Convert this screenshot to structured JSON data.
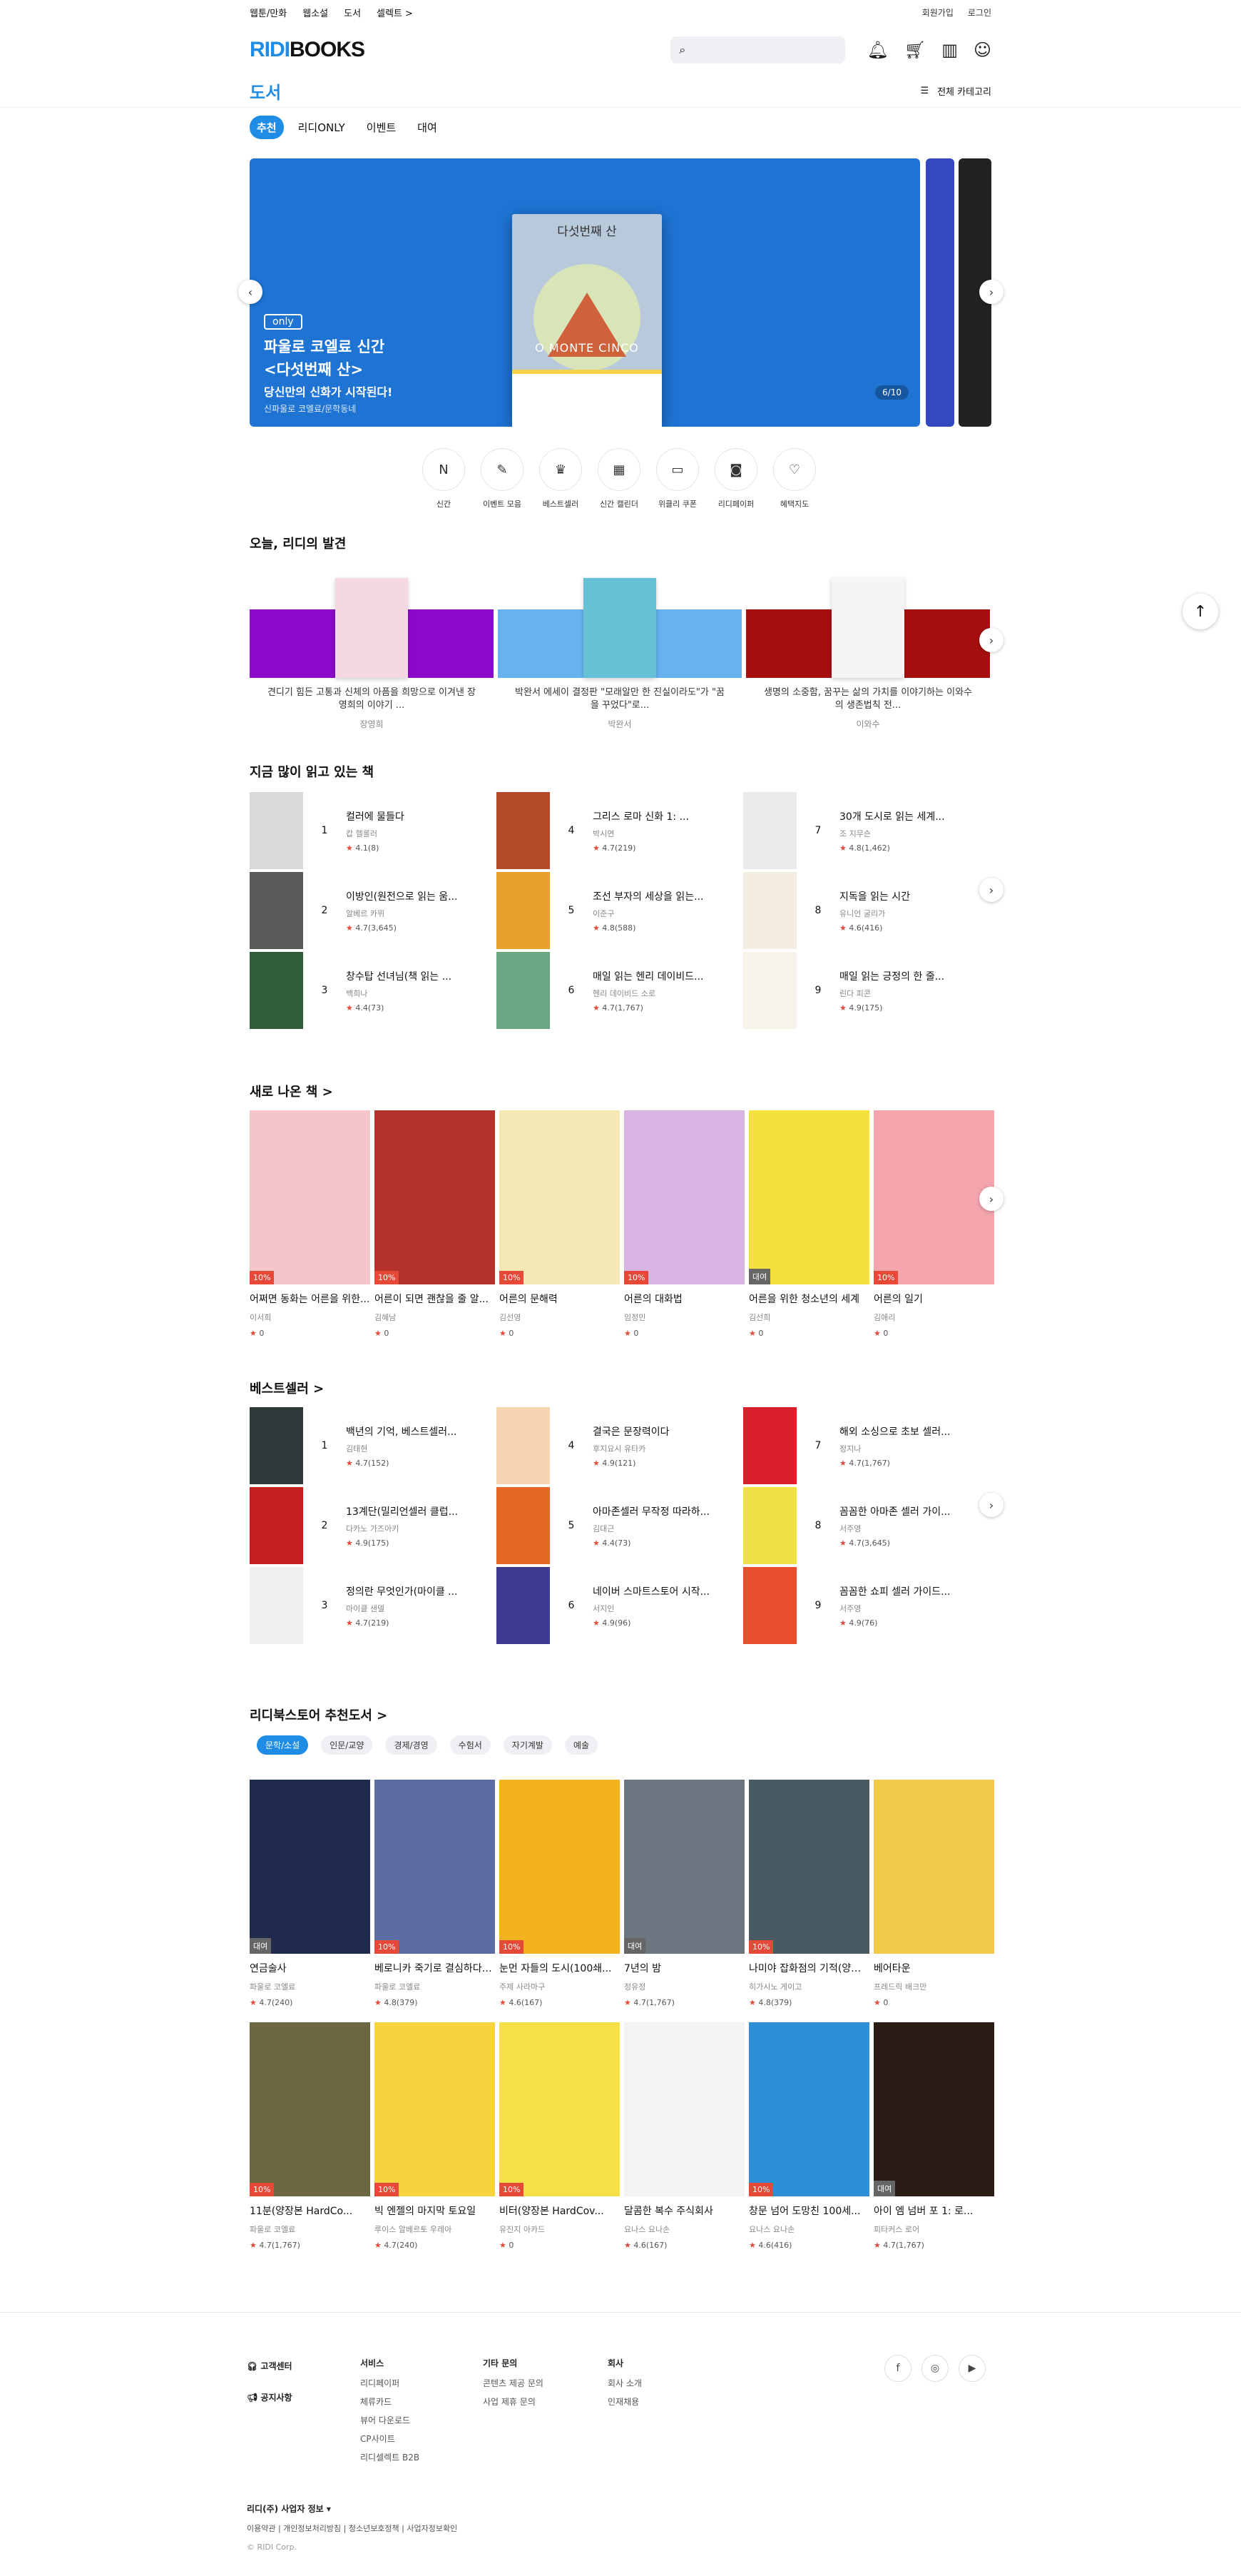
{
  "topnav": {
    "links": [
      "웹툰/만화",
      "웹소설",
      "도서",
      "셀렉트 >"
    ],
    "signup": "회원가입",
    "login": "로그인"
  },
  "header": {
    "logo_a": "RIDI",
    "logo_b": "BOOKS",
    "icons": [
      "search-icon",
      "bell-icon",
      "cart-icon",
      "library-icon",
      "user-icon"
    ]
  },
  "page": {
    "title": "도서",
    "all_categories": "전체 카테고리",
    "tabs": [
      "추천",
      "리디ONLY",
      "이벤트",
      "대여"
    ]
  },
  "banner": {
    "book_title": "다섯번째 산",
    "book_en": "O MONTE CINCO",
    "badge": "only",
    "line1": "파울로 코엘료 신간",
    "line2": "<다섯번째 산>",
    "line3": "당신만의 신화가 시작된다!",
    "caption": "신파울로 코엘료/문학동네",
    "page": "6/10"
  },
  "quick_menu": [
    {
      "icon": "N",
      "label": "신간"
    },
    {
      "icon": "✎",
      "label": "이벤트 모음"
    },
    {
      "icon": "♛",
      "label": "베스트셀러"
    },
    {
      "icon": "▦",
      "label": "신간 캘린더"
    },
    {
      "icon": "▭",
      "label": "위클리 쿠폰"
    },
    {
      "icon": "◙",
      "label": "리디페이퍼"
    },
    {
      "icon": "♡",
      "label": "혜택지도"
    }
  ],
  "discovery": {
    "title": "오늘, 리디의 발견",
    "items": [
      {
        "desc": "견디기 힘든 고통과 신체의 아픔을 희망으로 이겨낸 장영희의 이야기 ...",
        "author": "장영희",
        "bg": "#8b0ac9",
        "cover": "#f4d9e3"
      },
      {
        "desc": "박완서 에세이 결정판 \"모래알만 한 진실이라도\"가 \"꿈을 꾸었다\"로...",
        "author": "박완서",
        "bg": "#67b2ef",
        "cover": "#66c1d4"
      },
      {
        "desc": "생명의 소중함, 꿈꾸는 삶의 가치를 이야기하는 이와수의 생존법칙 전...",
        "author": "이와수",
        "bg": "#a50f0f",
        "cover": "#f5f5f5"
      }
    ]
  },
  "reading": {
    "title": "지금 많이 읽고 있는 책",
    "items": [
      {
        "rank": "1",
        "title": "컬러에 물들다",
        "author": "캅 헬롤러",
        "rating": "4.1",
        "count": "(8)",
        "color": "#d9d9d9"
      },
      {
        "rank": "2",
        "title": "이방인(원전으로 읽는 움...",
        "author": "알베르 카뮈",
        "rating": "4.7",
        "count": "(3,645)",
        "color": "#5a5a5a"
      },
      {
        "rank": "3",
        "title": "창수탑 선녀님(책 읽는 ...",
        "author": "백희나",
        "rating": "4.4",
        "count": "(73)",
        "color": "#2f5d3a"
      },
      {
        "rank": "4",
        "title": "그리스 로마 신화 1: ...",
        "author": "박시연",
        "rating": "4.7",
        "count": "(219)",
        "color": "#b54a2b"
      },
      {
        "rank": "5",
        "title": "조선 부자의 세상을 읽는...",
        "author": "이준구",
        "rating": "4.8",
        "count": "(588)",
        "color": "#e9a12e"
      },
      {
        "rank": "6",
        "title": "매일 읽는 헨리 데이비드...",
        "author": "헨리 데이비드 소로",
        "rating": "4.7",
        "count": "(1,767)",
        "color": "#6aa584"
      },
      {
        "rank": "7",
        "title": "30개 도시로 읽는 세계...",
        "author": "조 지무슨",
        "rating": "4.8",
        "count": "(1,462)",
        "color": "#eaeaea"
      },
      {
        "rank": "8",
        "title": "지독을 읽는 시간",
        "author": "유니언 굴리가",
        "rating": "4.6",
        "count": "(416)",
        "color": "#f3ede2"
      },
      {
        "rank": "9",
        "title": "매일 읽는 긍정의 한 줄...",
        "author": "린다 피콘",
        "rating": "4.9",
        "count": "(175)",
        "color": "#f7f2ea"
      }
    ]
  },
  "new_books": {
    "title": "새로 나온 책 >",
    "items": [
      {
        "title": "어쩌면 동화는 어른을 위한...",
        "author": "이서희",
        "rating": "0",
        "badge": "10%",
        "color": "#f5c6c9"
      },
      {
        "title": "어른이 되면 괜찮을 줄 알...",
        "author": "김혜남",
        "rating": "0",
        "badge": "10%",
        "color": "#b5312b"
      },
      {
        "title": "어른의 문해력",
        "author": "김선영",
        "rating": "0",
        "badge": "10%",
        "color": "#f6e8b5"
      },
      {
        "title": "어른의 대화법",
        "author": "임정민",
        "rating": "0",
        "badge": "10%",
        "color": "#d8b4e2"
      },
      {
        "title": "어른을 위한 청소년의 세계",
        "author": "김선희",
        "rating": "0",
        "badge": "대여",
        "color": "#f3e23c"
      },
      {
        "title": "어른의 일기",
        "author": "김애리",
        "rating": "0",
        "badge": "10%",
        "color": "#f3a4ad"
      }
    ]
  },
  "bestseller": {
    "title": "베스트셀러 >",
    "items": [
      {
        "rank": "1",
        "title": "백년의 기억, 베스트셀러...",
        "author": "김태현",
        "rating": "4.7",
        "count": "(152)",
        "color": "#2e3b3a"
      },
      {
        "rank": "2",
        "title": "13계단(밀리언셀러 클럽...",
        "author": "다카노 가즈아키",
        "rating": "4.9",
        "count": "(175)",
        "color": "#c41f1f"
      },
      {
        "rank": "3",
        "title": "정의란 무엇인가(마이클 ...",
        "author": "마이클 샌델",
        "rating": "4.7",
        "count": "(219)",
        "color": "#efefef"
      },
      {
        "rank": "4",
        "title": "결국은 문장력이다",
        "author": "후지요시 유타카",
        "rating": "4.9",
        "count": "(121)",
        "color": "#f6d6b2"
      },
      {
        "rank": "5",
        "title": "아마존셀러 무작정 따라하...",
        "author": "김대근",
        "rating": "4.4",
        "count": "(73)",
        "color": "#e46725"
      },
      {
        "rank": "6",
        "title": "네이버 스마트스토어 시작...",
        "author": "서지인",
        "rating": "4.9",
        "count": "(96)",
        "color": "#3e3a90"
      },
      {
        "rank": "7",
        "title": "해외 소싱으로 초보 셀러...",
        "author": "정지나",
        "rating": "4.7",
        "count": "(1,767)",
        "color": "#d81f2a"
      },
      {
        "rank": "8",
        "title": "꼼꼼한 아마존 셀러 가이...",
        "author": "서주영",
        "rating": "4.7",
        "count": "(3,645)",
        "color": "#f1e044"
      },
      {
        "rank": "9",
        "title": "꼼꼼한 쇼피 셀러 가이드...",
        "author": "서주영",
        "rating": "4.9",
        "count": "(76)",
        "color": "#e94f2c"
      }
    ]
  },
  "recommend": {
    "title": "리디북스토어 추천도서 >",
    "chips": [
      "문학/소설",
      "인문/교양",
      "경제/경영",
      "수험서",
      "자기계발",
      "예술"
    ],
    "row1": [
      {
        "title": "연금술사",
        "author": "파울로 코엘료",
        "rating": "4.7",
        "count": "(240)",
        "badge": "대여",
        "color": "#1f2a4d"
      },
      {
        "title": "베로니카 죽기로 결심하다(...",
        "author": "파울로 코엘료",
        "rating": "4.8",
        "count": "(379)",
        "badge": "10%",
        "color": "#5c6da5"
      },
      {
        "title": "눈먼 자들의 도시(100쇄...",
        "author": "주제 사라마구",
        "rating": "4.6",
        "count": "(167)",
        "badge": "10%",
        "color": "#f3b31f"
      },
      {
        "title": "7년의 밤",
        "author": "정유정",
        "rating": "4.7",
        "count": "(1,767)",
        "badge": "대여",
        "color": "#6c7680"
      },
      {
        "title": "나미야 잡화점의 기적(양장...",
        "author": "히가시노 게이고",
        "rating": "4.8",
        "count": "(379)",
        "badge": "10%",
        "color": "#4a5a63"
      },
      {
        "title": "베어타운",
        "author": "프레드릭 배크만",
        "rating": "0",
        "count": "",
        "badge": "",
        "color": "#f2c84a"
      }
    ],
    "row2": [
      {
        "title": "11분(양장본 HardCo...",
        "author": "파울로 코엘료",
        "rating": "4.7",
        "count": "(1,767)",
        "badge": "10%",
        "color": "#6a6741"
      },
      {
        "title": "빅 엔젤의 마지막 토요일",
        "author": "루이스 알베르토 우레아",
        "rating": "4.7",
        "count": "(240)",
        "badge": "10%",
        "color": "#f7d43e"
      },
      {
        "title": "비터(양장본 HardCov...",
        "author": "유진지 아카드",
        "rating": "0",
        "count": "",
        "badge": "10%",
        "color": "#f6e04a"
      },
      {
        "title": "달콤한 복수 주식회사",
        "author": "요나스 요나손",
        "rating": "4.6",
        "count": "(167)",
        "badge": "",
        "color": "#f3f3f6"
      },
      {
        "title": "창문 넘어 도망친 100세...",
        "author": "요나스 요나손",
        "rating": "4.6",
        "count": "(416)",
        "badge": "10%",
        "color": "#2e8fd6"
      },
      {
        "title": "아이 엠 넘버 포 1: 로...",
        "author": "피타커스 로어",
        "rating": "4.7",
        "count": "(1,767)",
        "badge": "대여",
        "color": "#2a1b15"
      }
    ]
  },
  "footer": {
    "cs": "고객센터",
    "notice": "공지사항",
    "service_h": "서비스",
    "service": [
      "리디페이퍼",
      "체류카드",
      "뷰어 다운로드",
      "CP사이트",
      "리디셀렉트 B2B"
    ],
    "other_h": "기타 문의",
    "other": [
      "콘텐츠 제공 문의",
      "사업 제휴 문의"
    ],
    "company_h": "회사",
    "company": [
      "회사 소개",
      "인재채용"
    ],
    "biz": "리디(주) 사업자 정보 ▾",
    "links": "이용약관  |  개인정보처리방침  |  청소년보호정책  |  사업자정보확인",
    "copy": "© RIDI Corp."
  }
}
